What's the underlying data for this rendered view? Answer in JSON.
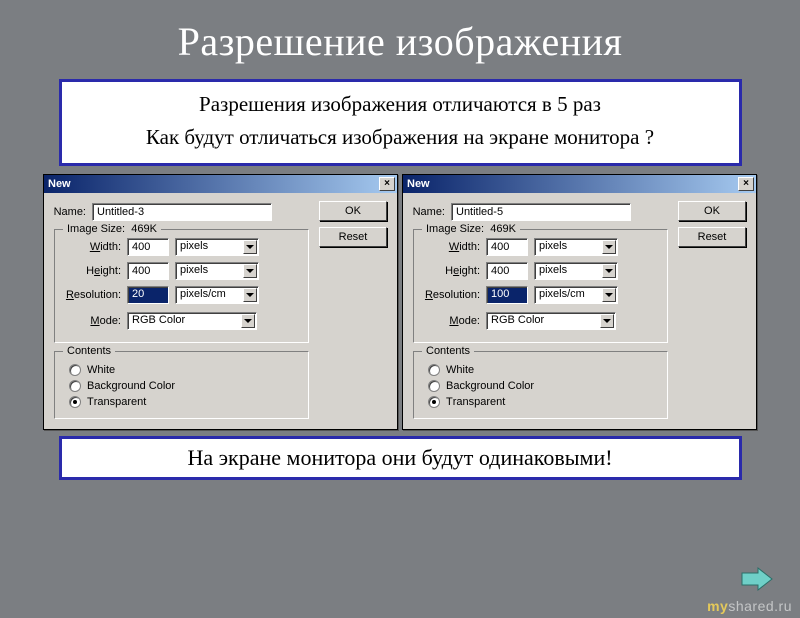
{
  "slide": {
    "title": "Разрешение изображения",
    "question_line1": "Разрешения изображения отличаются в 5 раз",
    "question_line2": "Как будут отличаться изображения на экране монитора ?",
    "answer": "На экране монитора они будут одинаковыми!"
  },
  "dialog_left": {
    "title": "New",
    "close": "×",
    "name_label": "Name:",
    "name_value": "Untitled-3",
    "ok": "OK",
    "reset": "Reset",
    "image_size_label": "Image Size:",
    "image_size_value": "469K",
    "width_label_pre": "",
    "width_label_u": "W",
    "width_label_post": "idth:",
    "width_value": "400",
    "height_label_pre": "H",
    "height_label_u": "e",
    "height_label_post": "ight:",
    "height_value": "400",
    "res_label_pre": "",
    "res_label_u": "R",
    "res_label_post": "esolution:",
    "res_value": "20",
    "units_px": "pixels",
    "units_res": "pixels/cm",
    "mode_label_pre": "",
    "mode_label_u": "M",
    "mode_label_post": "ode:",
    "mode_value": "RGB Color",
    "contents_label": "Contents",
    "opt_white_u": "W",
    "opt_white_post": "hite",
    "opt_bg_u": "B",
    "opt_bg_post": "ackground Color",
    "opt_trans_u": "T",
    "opt_trans_post": "ransparent",
    "selected": "transparent"
  },
  "dialog_right": {
    "title": "New",
    "close": "×",
    "name_label": "Name:",
    "name_value": "Untitled-5",
    "ok": "OK",
    "reset": "Reset",
    "image_size_label": "Image Size:",
    "image_size_value": "469K",
    "width_value": "400",
    "height_value": "400",
    "res_value": "100",
    "units_px": "pixels",
    "units_res": "pixels/cm",
    "mode_value": "RGB Color",
    "contents_label": "Contents",
    "selected": "transparent"
  },
  "watermark": {
    "my": "my",
    "shared": "shared",
    "ru": ".ru"
  }
}
